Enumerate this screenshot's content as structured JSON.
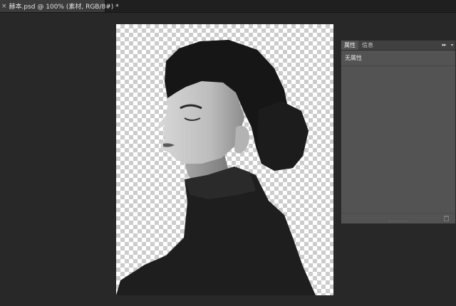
{
  "document_tab": {
    "close_glyph": "×",
    "title": "赫本.psd @ 100% (素材, RGB/8#) *"
  },
  "canvas": {
    "layer_name": "素材",
    "subject": "woman-portrait-cutout"
  },
  "properties_panel": {
    "tabs": [
      {
        "label": "属性",
        "active": true
      },
      {
        "label": "信息",
        "active": false
      }
    ],
    "collapse_glyph": "▸▸",
    "menu_glyph": "▾",
    "content_text": "无属性"
  },
  "colors": {
    "workspace_bg": "#282828",
    "panel_bg": "#535353",
    "tab_active": "#3b3b3b"
  }
}
